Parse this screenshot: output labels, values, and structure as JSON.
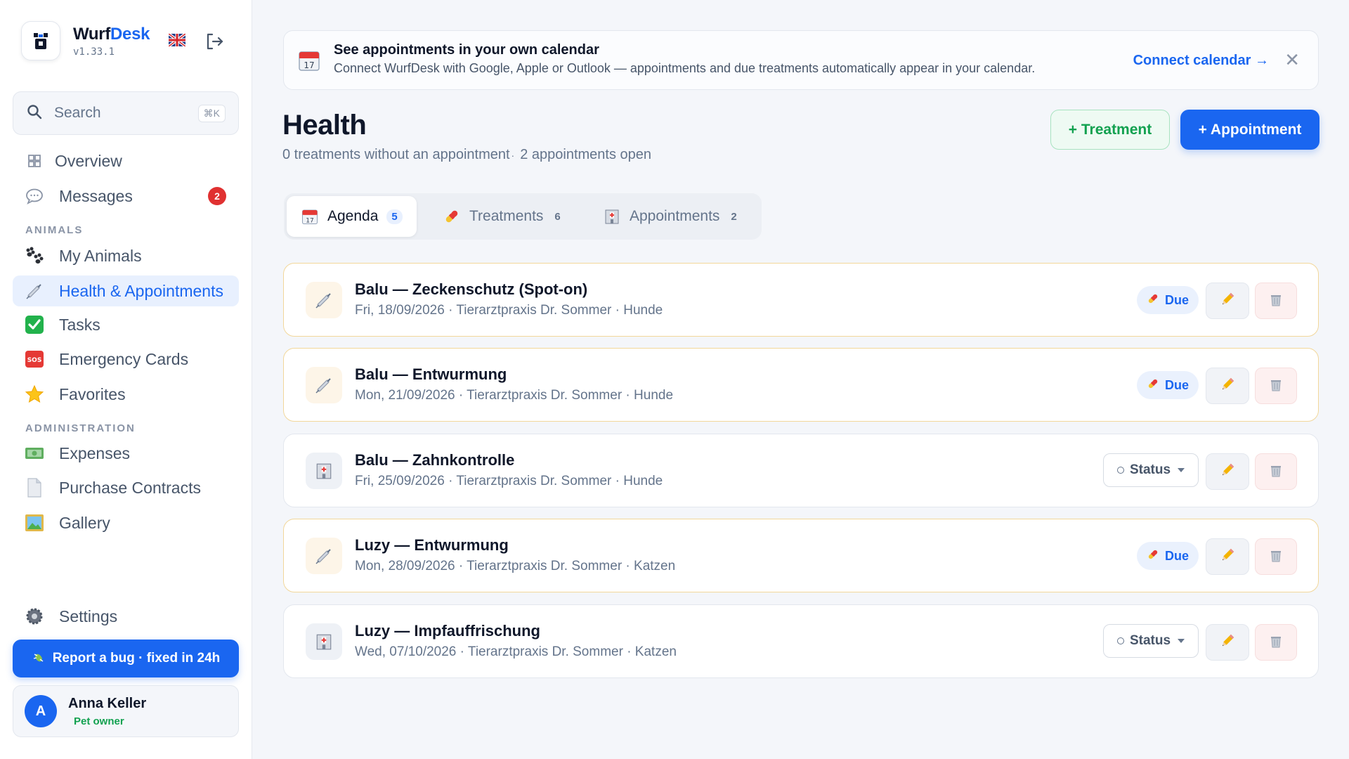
{
  "brand": {
    "name_part1": "Wurf",
    "name_part2": "Desk",
    "version": "v1.33.1"
  },
  "search": {
    "placeholder": "Search",
    "shortcut": "⌘K"
  },
  "nav": {
    "overview": "Overview",
    "messages": "Messages",
    "messages_badge": "2",
    "section_animals": "ANIMALS",
    "my_animals": "My Animals",
    "health": "Health & Appointments",
    "tasks": "Tasks",
    "emergency": "Emergency Cards",
    "favorites": "Favorites",
    "section_admin": "ADMINISTRATION",
    "expenses": "Expenses",
    "purchase": "Purchase Contracts",
    "gallery": "Gallery",
    "settings": "Settings"
  },
  "bug_button": "Report a bug · fixed in 24h",
  "user": {
    "initial": "A",
    "name": "Anna Keller",
    "role": "Pet owner"
  },
  "banner": {
    "title": "See appointments in your own calendar",
    "text": "Connect WurfDesk with Google, Apple or Outlook — appointments and due treatments automatically appear in your calendar.",
    "link": "Connect calendar →",
    "close": "✕"
  },
  "page": {
    "title": "Health",
    "subtitle_a": "0 treatments without an appointment",
    "subtitle_b": "2 appointments open",
    "btn_treatment": "+ Treatment",
    "btn_appointment": "+ Appointment"
  },
  "tabs": [
    {
      "label": "Agenda",
      "count": "5"
    },
    {
      "label": "Treatments",
      "count": "6"
    },
    {
      "label": "Appointments",
      "count": "2"
    }
  ],
  "items": [
    {
      "title": "Balu — Zeckenschutz (Spot-on)",
      "meta": "Fri, 18/09/2026 · Tierarztpraxis Dr. Sommer · Hunde",
      "status": "Due"
    },
    {
      "title": "Balu — Entwurmung",
      "meta": "Mon, 21/09/2026 · Tierarztpraxis Dr. Sommer · Hunde",
      "status": "Due"
    },
    {
      "title": "Balu — Zahnkontrolle",
      "meta": "Fri, 25/09/2026 · Tierarztpraxis Dr. Sommer · Hunde",
      "status": "Status"
    },
    {
      "title": "Luzy — Entwurmung",
      "meta": "Mon, 28/09/2026 · Tierarztpraxis Dr. Sommer · Katzen",
      "status": "Due"
    },
    {
      "title": "Luzy — Impfauffrischung",
      "meta": "Wed, 07/10/2026 · Tierarztpraxis Dr. Sommer · Katzen",
      "status": "Status"
    }
  ],
  "colors": {
    "accent": "#1a66f0",
    "success": "#12a150",
    "danger": "#e03131",
    "due_border": "#f2d79a"
  }
}
